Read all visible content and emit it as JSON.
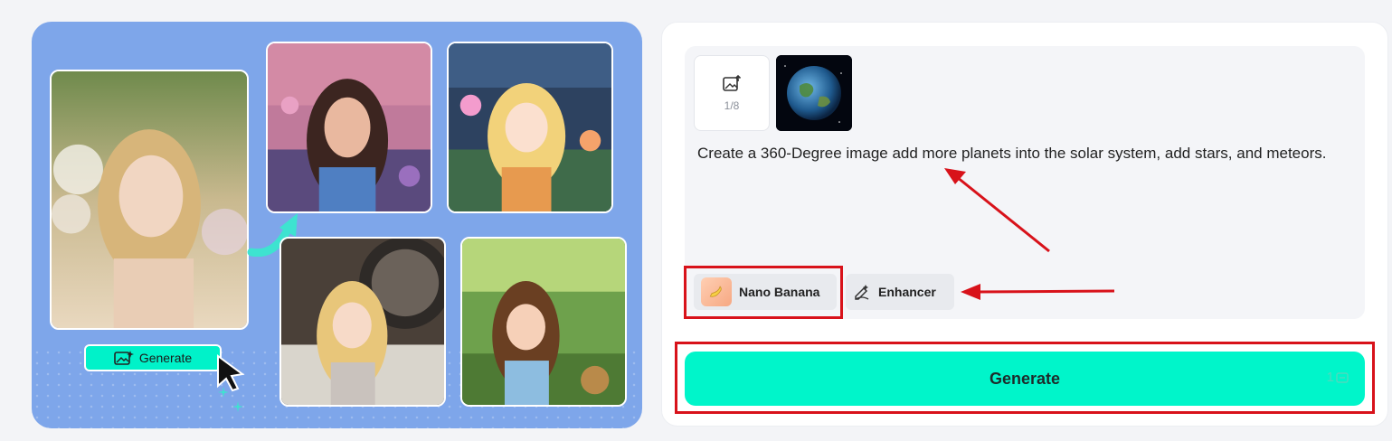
{
  "illustration": {
    "mini_generate_label": "Generate"
  },
  "prompt_panel": {
    "upload_count": "1/8",
    "prompt_text": "Create a 360-Degree image add more planets into the solar system, add stars, and meteors.",
    "chips": {
      "nano_banana_label": "Nano Banana",
      "enhancer_label": "Enhancer"
    }
  },
  "generate_button": {
    "label": "Generate",
    "cost": "1"
  },
  "colors": {
    "accent": "#00f5ca",
    "panel_blue": "#7ea6ea",
    "annotation_red": "#d8121a"
  },
  "icons": [
    "image-add-icon",
    "cursor-icon",
    "sparkle-icon",
    "banana-icon",
    "enhancer-icon",
    "credit-icon"
  ]
}
